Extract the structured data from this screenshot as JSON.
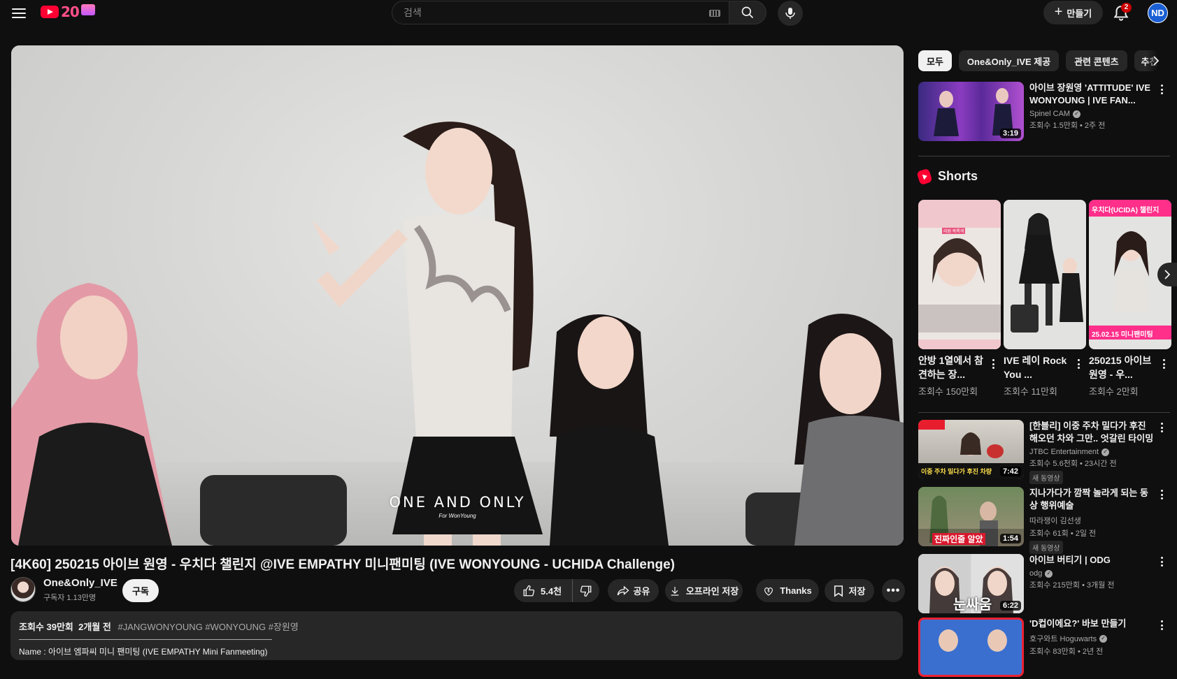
{
  "header": {
    "logo_text": "20",
    "search_placeholder": "검색",
    "create_label": "만들기",
    "notification_count": "2",
    "avatar_initials": "ND"
  },
  "player": {
    "caption_main": "ONE AND ONLY",
    "caption_sub": "For WonYoung"
  },
  "video": {
    "title": "[4K60] 250215 아이브 원영 - 우치다 챌린지 @IVE EMPATHY 미니팬미팅 (IVE WONYOUNG - UCHIDA Challenge)",
    "channel_name": "One&Only_IVE",
    "subscribers": "구독자 1.13만명",
    "subscribe_label": "구독",
    "like_count": "5.4천",
    "share_label": "공유",
    "download_label": "오프라인 저장",
    "thanks_label": "Thanks",
    "save_label": "저장",
    "views": "조회수 39만회",
    "age": "2개월 전",
    "hashtags": "#JANGWONYOUNG #WONYOUNG #장원영",
    "desc_line": "Name : 아이브 엠파씨 미니 팬미팅 (IVE EMPATHY Mini Fanmeeting)"
  },
  "chips": [
    "모두",
    "One&Only_IVE 제공",
    "관련 콘텐츠",
    "추천"
  ],
  "recommendations_top": [
    {
      "title": "아이브 장원영 'ATTITUDE' IVE WONYOUNG | IVE FAN...",
      "channel": "Spinel CAM",
      "views": "조회수 1.5만회",
      "age": "2주 전",
      "duration": "3:19",
      "verified": true
    }
  ],
  "shorts": {
    "heading": "Shorts",
    "items": [
      {
        "title": "안방 1열에서 참견하는 장...",
        "views": "조회수 150만회",
        "thumb_text": "리원 목록색"
      },
      {
        "title": "IVE 레이 Rock You ...",
        "views": "조회수 11만회",
        "thumb_text": ""
      },
      {
        "title": "250215 아이브 원영 - 우...",
        "views": "조회수 2만회",
        "thumb_text": "우치다(UCIDA) 챌린지",
        "thumb_text2": "25.02.15 미니팬미팅"
      }
    ]
  },
  "recommendations": [
    {
      "title": "[한블리] 이중 주차 밀다가 후진해오던 차와 그만.. 엇갈린 타이밍의 ...",
      "channel": "JTBC Entertainment",
      "views": "조회수 5.6천회",
      "age": "23시간 전",
      "duration": "7:42",
      "verified": true,
      "badge": "새 동영상",
      "thumb_text": "이중 주차 밀다가 후진 차량"
    },
    {
      "title": "지나가다가 깜짝 놀라게 되는 동상 행위예술",
      "channel": "따라쟁이 김선생",
      "views": "조회수 61회",
      "age": "2일 전",
      "duration": "1:54",
      "verified": false,
      "badge": "새 동영상",
      "thumb_text": "진짜인줄 알았"
    },
    {
      "title": "아이브 버티기 | ODG",
      "channel": "odg",
      "views": "조회수 215만회",
      "age": "3개월 전",
      "duration": "6:22",
      "verified": true,
      "badge": "",
      "thumb_text": "눈싸움"
    },
    {
      "title": "'D컵이에요?' 바보 만들기",
      "channel": "호구와트 Hoguwarts",
      "views": "조회수 83만회",
      "age": "2년 전",
      "duration": "",
      "verified": true,
      "badge": "",
      "thumb_text": ""
    }
  ]
}
